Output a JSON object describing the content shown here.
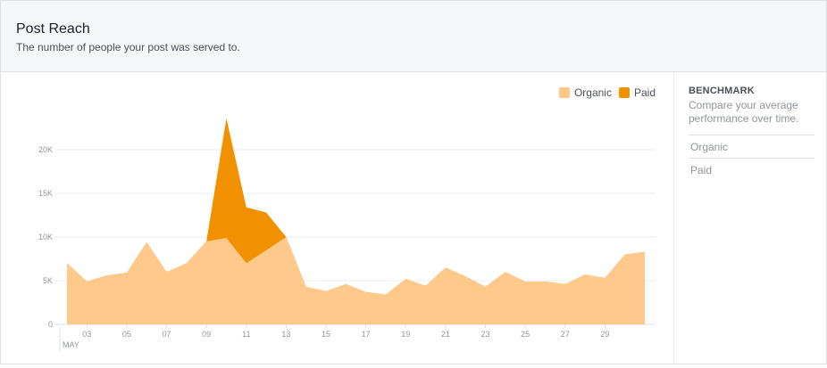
{
  "header": {
    "title": "Post Reach",
    "subtitle": "The number of people your post was served to."
  },
  "legend": {
    "organic_label": "Organic",
    "paid_label": "Paid"
  },
  "sidebar": {
    "title": "BENCHMARK",
    "description": "Compare your average performance over time.",
    "items": [
      {
        "label": "Organic"
      },
      {
        "label": "Paid"
      }
    ]
  },
  "colors": {
    "organic": "#ffc98b",
    "paid": "#f29100",
    "grid": "#ebedf0",
    "axis_text": "#90949c"
  },
  "chart_data": {
    "type": "area",
    "stacked": true,
    "x": [
      2,
      3,
      4,
      5,
      6,
      7,
      8,
      9,
      10,
      11,
      12,
      13,
      14,
      15,
      16,
      17,
      18,
      19,
      20,
      21,
      22,
      23,
      24,
      25,
      26,
      27,
      28,
      29,
      30,
      31
    ],
    "series": [
      {
        "name": "Organic",
        "values": [
          7000,
          4900,
          5600,
          5900,
          9400,
          6000,
          7000,
          9500,
          9900,
          7000,
          8500,
          10000,
          4300,
          3800,
          4600,
          3700,
          3400,
          5200,
          4400,
          6500,
          5500,
          4300,
          6000,
          4900,
          4900,
          4600,
          5700,
          5300,
          8000,
          8300
        ]
      },
      {
        "name": "Paid",
        "values": [
          0,
          0,
          0,
          0,
          0,
          0,
          0,
          0,
          13700,
          6400,
          4300,
          0,
          0,
          0,
          0,
          0,
          0,
          0,
          0,
          0,
          0,
          0,
          0,
          0,
          0,
          0,
          0,
          0,
          0,
          0
        ]
      }
    ],
    "xticks": [
      "03",
      "05",
      "07",
      "09",
      "11",
      "13",
      "15",
      "17",
      "19",
      "21",
      "23",
      "25",
      "27",
      "29"
    ],
    "xtick_values": [
      3,
      5,
      7,
      9,
      11,
      13,
      15,
      17,
      19,
      21,
      23,
      25,
      27,
      29
    ],
    "month_label": "MAY",
    "yticks": [
      "0",
      "5K",
      "10K",
      "15K",
      "20K"
    ],
    "ytick_values": [
      0,
      5000,
      10000,
      15000,
      20000
    ],
    "ylim": [
      0,
      20000
    ],
    "grid": true,
    "legend_position": "top-right"
  }
}
